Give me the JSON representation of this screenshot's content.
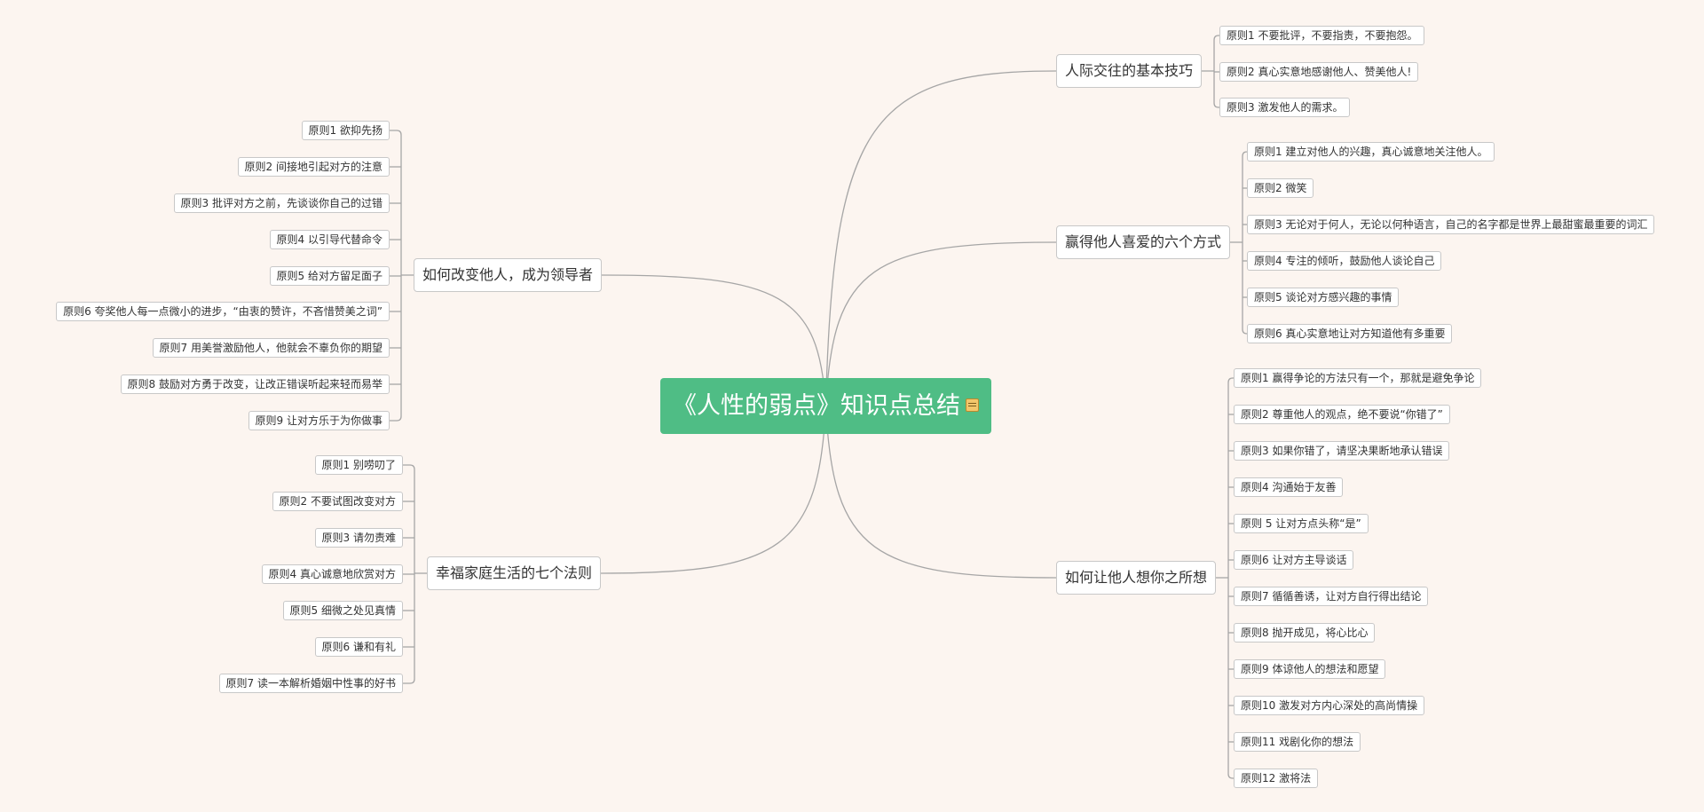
{
  "root": {
    "title": "《人性的弱点》知识点总结",
    "note_icon": "note-icon"
  },
  "branches": [
    {
      "key": "basic",
      "title": "人际交往的基本技巧",
      "items": [
        "原则1 不要批评，不要指责，不要抱怨。",
        "原则2 真心实意地感谢他人、赞美他人!",
        "原则3 激发他人的需求。"
      ]
    },
    {
      "key": "liked",
      "title": "赢得他人喜爱的六个方式",
      "items": [
        "原则1 建立对他人的兴趣，真心诚意地关注他人。",
        "原则2 微笑",
        "原则3 无论对于何人，无论以何种语言，自己的名字都是世界上最甜蜜最重要的词汇",
        "原则4 专注的倾听，鼓励他人谈论自己",
        "原则5 谈论对方感兴趣的事情",
        "原则6 真心实意地让对方知道他有多重要"
      ]
    },
    {
      "key": "think",
      "title": "如何让他人想你之所想",
      "items": [
        "原则1 赢得争论的方法只有一个，那就是避免争论",
        "原则2 尊重他人的观点，绝不要说“你错了”",
        "原则3 如果你错了，请坚决果断地承认错误",
        "原则4 沟通始于友善",
        "原则 5 让对方点头称“是”",
        "原则6 让对方主导谈话",
        "原则7 循循善诱，让对方自行得出结论",
        "原则8 抛开成见，将心比心",
        "原则9 体谅他人的想法和愿望",
        "原则10 激发对方内心深处的高尚情操",
        "原则11 戏剧化你的想法",
        "原则12 激将法"
      ]
    },
    {
      "key": "leader",
      "title": "如何改变他人，成为领导者",
      "items": [
        "原则1 欲抑先扬",
        "原则2 间接地引起对方的注意",
        "原则3 批评对方之前，先谈谈你自己的过错",
        "原则4 以引导代替命令",
        "原则5 给对方留足面子",
        "原则6 夸奖他人每一点微小的进步，“由衷的赞许，不吝惜赞美之词”",
        "原则7 用美誉激励他人，他就会不辜负你的期望",
        "原则8 鼓励对方勇于改变，让改正错误听起来轻而易举",
        "原则9 让对方乐于为你做事"
      ]
    },
    {
      "key": "family",
      "title": "幸福家庭生活的七个法则",
      "items": [
        "原则1 别唠叨了",
        "原则2 不要试图改变对方",
        "原则3 请勿责难",
        "原则4 真心诚意地欣赏对方",
        "原则5 细微之处见真情",
        "原则6 谦和有礼",
        "原则7 读一本解析婚姻中性事的好书"
      ]
    }
  ],
  "colors": {
    "background": "#fcf5f0",
    "root": "#4fbd85",
    "line": "#a6a6a6",
    "border": "#c8c8c8"
  }
}
